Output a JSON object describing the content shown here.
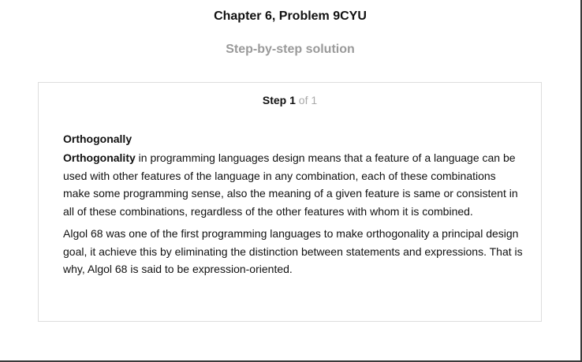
{
  "header": {
    "title": "Chapter 6, Problem 9CYU",
    "subtitle": "Step-by-step solution"
  },
  "step": {
    "label": "Step",
    "number": "1",
    "of_text": "of 1"
  },
  "solution": {
    "heading": "Orthogonally",
    "para1_term": "Orthogonality",
    "para1_text": " in programming languages design means that a feature of a language can be used with other features of the language in any combination, each of these combinations make some programming sense, also the meaning of a given feature is same or consistent in all of these combinations, regardless of the other features with whom it is combined.",
    "para2_text": "Algol 68 was one of the first programming languages to make orthogonality a principal design goal, it achieve this by eliminating the distinction between statements and expressions. That is why, Algol 68 is said to be expression-oriented."
  }
}
